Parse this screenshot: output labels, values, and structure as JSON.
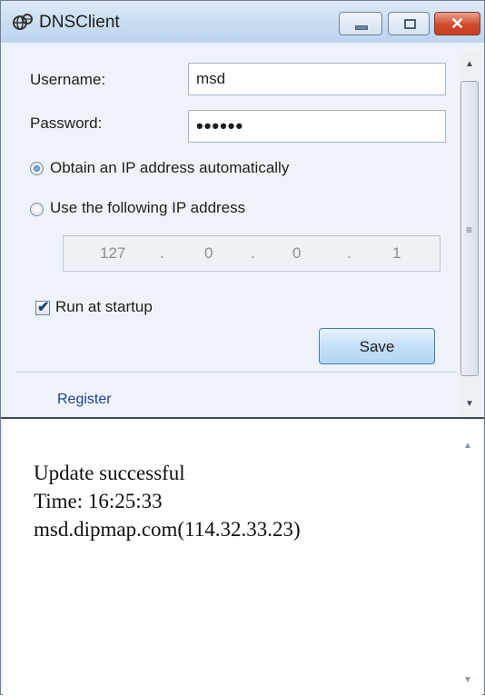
{
  "window": {
    "title": "DNSClient",
    "icon": "network-globe-icon"
  },
  "form": {
    "username_label": "Username:",
    "username_value": "msd",
    "password_label": "Password:",
    "password_masked": "••••••",
    "radio_auto_label": "Obtain an IP address automatically",
    "radio_auto_selected": true,
    "radio_manual_label": "Use the following IP address",
    "ip": [
      "127",
      "0",
      "0",
      "1"
    ],
    "ip_separator": ".",
    "startup_label": "Run at startup",
    "startup_checked": true,
    "save_label": "Save",
    "register_label": "Register"
  },
  "log": {
    "lines": [
      "Update successful",
      "Time: 16:25:33",
      "msd.dipmap.com(114.32.33.23)"
    ]
  },
  "colors": {
    "link": "#1f3f8f",
    "close_button": "#c6401f",
    "accent_button": "#3c7fb1"
  }
}
